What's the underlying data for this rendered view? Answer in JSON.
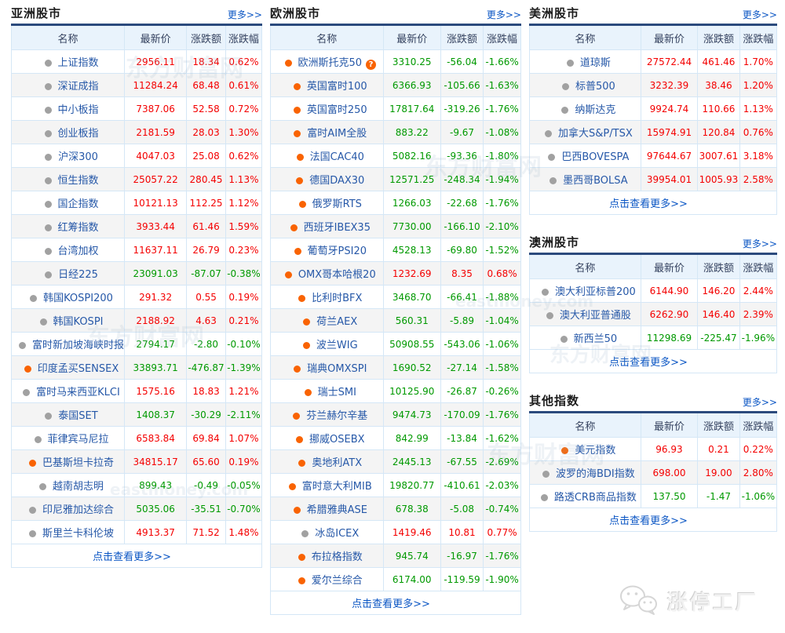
{
  "colors": {
    "up": "#f40000",
    "down": "#009900",
    "link": "#0b56c4",
    "name_link": "#2658a8",
    "header_bg": "#e9f3fc",
    "row_alt_bg": "#f4f4f4",
    "border": "#d5e7f6",
    "outer_border": "#c3daf0",
    "table_top": "#2b4a7d",
    "title_color": "#1c1c1c",
    "bullet_gray": "#a1a1a1",
    "bullet_orange": "#f96302"
  },
  "labels": {
    "more": "更多>>",
    "view_more": "点击查看更多>>",
    "help": "?",
    "columns": [
      "名称",
      "最新价",
      "涨跌额",
      "涨跌幅"
    ]
  },
  "watermarks": {
    "site": "东方财富网",
    "domain": "eastmoney.com"
  },
  "brand": {
    "name": "涨停工厂"
  },
  "sections": {
    "asia": {
      "title": "亚洲股市",
      "rows": [
        {
          "name": "上证指数",
          "bullet": "gray",
          "price": "2956.11",
          "change": "18.34",
          "pct": "0.62%",
          "dir": "up"
        },
        {
          "name": "深证成指",
          "bullet": "gray",
          "price": "11284.24",
          "change": "68.48",
          "pct": "0.61%",
          "dir": "up"
        },
        {
          "name": "中小板指",
          "bullet": "gray",
          "price": "7387.06",
          "change": "52.58",
          "pct": "0.72%",
          "dir": "up"
        },
        {
          "name": "创业板指",
          "bullet": "gray",
          "price": "2181.59",
          "change": "28.03",
          "pct": "1.30%",
          "dir": "up"
        },
        {
          "name": "沪深300",
          "bullet": "gray",
          "price": "4047.03",
          "change": "25.08",
          "pct": "0.62%",
          "dir": "up"
        },
        {
          "name": "恒生指数",
          "bullet": "gray",
          "price": "25057.22",
          "change": "280.45",
          "pct": "1.13%",
          "dir": "up"
        },
        {
          "name": "国企指数",
          "bullet": "gray",
          "price": "10121.13",
          "change": "112.25",
          "pct": "1.12%",
          "dir": "up"
        },
        {
          "name": "红筹指数",
          "bullet": "gray",
          "price": "3933.44",
          "change": "61.46",
          "pct": "1.59%",
          "dir": "up"
        },
        {
          "name": "台湾加权",
          "bullet": "gray",
          "price": "11637.11",
          "change": "26.79",
          "pct": "0.23%",
          "dir": "up"
        },
        {
          "name": "日经225",
          "bullet": "gray",
          "price": "23091.03",
          "change": "-87.07",
          "pct": "-0.38%",
          "dir": "down"
        },
        {
          "name": "韩国KOSPI200",
          "bullet": "gray",
          "price": "291.32",
          "change": "0.55",
          "pct": "0.19%",
          "dir": "up"
        },
        {
          "name": "韩国KOSPI",
          "bullet": "gray",
          "price": "2188.92",
          "change": "4.63",
          "pct": "0.21%",
          "dir": "up"
        },
        {
          "name": "富时新加坡海峡时报",
          "bullet": "gray",
          "price": "2794.17",
          "change": "-2.80",
          "pct": "-0.10%",
          "dir": "down"
        },
        {
          "name": "印度孟买SENSEX",
          "bullet": "orange",
          "price": "33893.71",
          "change": "-476.87",
          "pct": "-1.39%",
          "dir": "down"
        },
        {
          "name": "富时马来西亚KLCI",
          "bullet": "gray",
          "price": "1575.16",
          "change": "18.83",
          "pct": "1.21%",
          "dir": "up"
        },
        {
          "name": "泰国SET",
          "bullet": "gray",
          "price": "1408.37",
          "change": "-30.29",
          "pct": "-2.11%",
          "dir": "down"
        },
        {
          "name": "菲律宾马尼拉",
          "bullet": "gray",
          "price": "6583.84",
          "change": "69.84",
          "pct": "1.07%",
          "dir": "up"
        },
        {
          "name": "巴基斯坦卡拉奇",
          "bullet": "orange",
          "price": "34815.17",
          "change": "65.60",
          "pct": "0.19%",
          "dir": "up"
        },
        {
          "name": "越南胡志明",
          "bullet": "gray",
          "price": "899.43",
          "change": "-0.49",
          "pct": "-0.05%",
          "dir": "down"
        },
        {
          "name": "印尼雅加达综合",
          "bullet": "gray",
          "price": "5035.06",
          "change": "-35.51",
          "pct": "-0.70%",
          "dir": "down"
        },
        {
          "name": "斯里兰卡科伦坡",
          "bullet": "gray",
          "price": "4913.37",
          "change": "71.52",
          "pct": "1.48%",
          "dir": "up"
        }
      ]
    },
    "europe": {
      "title": "欧洲股市",
      "rows": [
        {
          "name": "欧洲斯托克50",
          "bullet": "orange",
          "help": true,
          "price": "3310.25",
          "change": "-56.04",
          "pct": "-1.66%",
          "dir": "down"
        },
        {
          "name": "英国富时100",
          "bullet": "orange",
          "price": "6366.93",
          "change": "-105.66",
          "pct": "-1.63%",
          "dir": "down"
        },
        {
          "name": "英国富时250",
          "bullet": "orange",
          "price": "17817.64",
          "change": "-319.26",
          "pct": "-1.76%",
          "dir": "down"
        },
        {
          "name": "富时AIM全股",
          "bullet": "orange",
          "price": "883.22",
          "change": "-9.67",
          "pct": "-1.08%",
          "dir": "down"
        },
        {
          "name": "法国CAC40",
          "bullet": "orange",
          "price": "5082.16",
          "change": "-93.36",
          "pct": "-1.80%",
          "dir": "down"
        },
        {
          "name": "德国DAX30",
          "bullet": "orange",
          "price": "12571.25",
          "change": "-248.34",
          "pct": "-1.94%",
          "dir": "down"
        },
        {
          "name": "俄罗斯RTS",
          "bullet": "orange",
          "price": "1266.03",
          "change": "-22.68",
          "pct": "-1.76%",
          "dir": "down"
        },
        {
          "name": "西班牙IBEX35",
          "bullet": "orange",
          "price": "7730.00",
          "change": "-166.10",
          "pct": "-2.10%",
          "dir": "down"
        },
        {
          "name": "葡萄牙PSI20",
          "bullet": "orange",
          "price": "4528.13",
          "change": "-69.80",
          "pct": "-1.52%",
          "dir": "down"
        },
        {
          "name": "OMX哥本哈根20",
          "bullet": "orange",
          "price": "1232.69",
          "change": "8.35",
          "pct": "0.68%",
          "dir": "up"
        },
        {
          "name": "比利时BFX",
          "bullet": "orange",
          "price": "3468.70",
          "change": "-66.41",
          "pct": "-1.88%",
          "dir": "down"
        },
        {
          "name": "荷兰AEX",
          "bullet": "orange",
          "price": "560.31",
          "change": "-5.89",
          "pct": "-1.04%",
          "dir": "down"
        },
        {
          "name": "波兰WIG",
          "bullet": "orange",
          "price": "50908.55",
          "change": "-543.06",
          "pct": "-1.06%",
          "dir": "down"
        },
        {
          "name": "瑞典OMXSPI",
          "bullet": "orange",
          "price": "1690.52",
          "change": "-27.14",
          "pct": "-1.58%",
          "dir": "down"
        },
        {
          "name": "瑞士SMI",
          "bullet": "orange",
          "price": "10125.90",
          "change": "-26.87",
          "pct": "-0.26%",
          "dir": "down"
        },
        {
          "name": "芬兰赫尔辛基",
          "bullet": "orange",
          "price": "9474.73",
          "change": "-170.09",
          "pct": "-1.76%",
          "dir": "down"
        },
        {
          "name": "挪威OSEBX",
          "bullet": "orange",
          "price": "842.99",
          "change": "-13.84",
          "pct": "-1.62%",
          "dir": "down"
        },
        {
          "name": "奥地利ATX",
          "bullet": "orange",
          "price": "2445.13",
          "change": "-67.55",
          "pct": "-2.69%",
          "dir": "down"
        },
        {
          "name": "富时意大利MIB",
          "bullet": "orange",
          "price": "19820.77",
          "change": "-410.61",
          "pct": "-2.03%",
          "dir": "down"
        },
        {
          "name": "希腊雅典ASE",
          "bullet": "orange",
          "price": "678.38",
          "change": "-5.08",
          "pct": "-0.74%",
          "dir": "down"
        },
        {
          "name": "冰岛ICEX",
          "bullet": "gray",
          "price": "1419.46",
          "change": "10.81",
          "pct": "0.77%",
          "dir": "up"
        },
        {
          "name": "布拉格指数",
          "bullet": "orange",
          "price": "945.74",
          "change": "-16.97",
          "pct": "-1.76%",
          "dir": "down"
        },
        {
          "name": "爱尔兰综合",
          "bullet": "orange",
          "price": "6174.00",
          "change": "-119.59",
          "pct": "-1.90%",
          "dir": "down"
        }
      ]
    },
    "america": {
      "title": "美洲股市",
      "rows": [
        {
          "name": "道琼斯",
          "bullet": "gray",
          "price": "27572.44",
          "change": "461.46",
          "pct": "1.70%",
          "dir": "up"
        },
        {
          "name": "标普500",
          "bullet": "gray",
          "price": "3232.39",
          "change": "38.46",
          "pct": "1.20%",
          "dir": "up"
        },
        {
          "name": "纳斯达克",
          "bullet": "gray",
          "price": "9924.74",
          "change": "110.66",
          "pct": "1.13%",
          "dir": "up"
        },
        {
          "name": "加拿大S&P/TSX",
          "bullet": "gray",
          "price": "15974.91",
          "change": "120.84",
          "pct": "0.76%",
          "dir": "up"
        },
        {
          "name": "巴西BOVESPA",
          "bullet": "gray",
          "price": "97644.67",
          "change": "3007.61",
          "pct": "3.18%",
          "dir": "up"
        },
        {
          "name": "墨西哥BOLSA",
          "bullet": "gray",
          "price": "39954.01",
          "change": "1005.93",
          "pct": "2.58%",
          "dir": "up"
        }
      ]
    },
    "australia": {
      "title": "澳洲股市",
      "rows": [
        {
          "name": "澳大利亚标普200",
          "bullet": "gray",
          "price": "6144.90",
          "change": "146.20",
          "pct": "2.44%",
          "dir": "up"
        },
        {
          "name": "澳大利亚普通股",
          "bullet": "gray",
          "price": "6262.90",
          "change": "146.40",
          "pct": "2.39%",
          "dir": "up"
        },
        {
          "name": "新西兰50",
          "bullet": "gray",
          "price": "11298.69",
          "change": "-225.47",
          "pct": "-1.96%",
          "dir": "down"
        }
      ]
    },
    "other": {
      "title": "其他指数",
      "rows": [
        {
          "name": "美元指数",
          "bullet": "orange",
          "price": "96.93",
          "change": "0.21",
          "pct": "0.22%",
          "dir": "up"
        },
        {
          "name": "波罗的海BDI指数",
          "bullet": "gray",
          "price": "698.00",
          "change": "19.00",
          "pct": "2.80%",
          "dir": "up"
        },
        {
          "name": "路透CRB商品指数",
          "bullet": "gray",
          "price": "137.50",
          "change": "-1.47",
          "pct": "-1.06%",
          "dir": "down"
        }
      ]
    }
  }
}
